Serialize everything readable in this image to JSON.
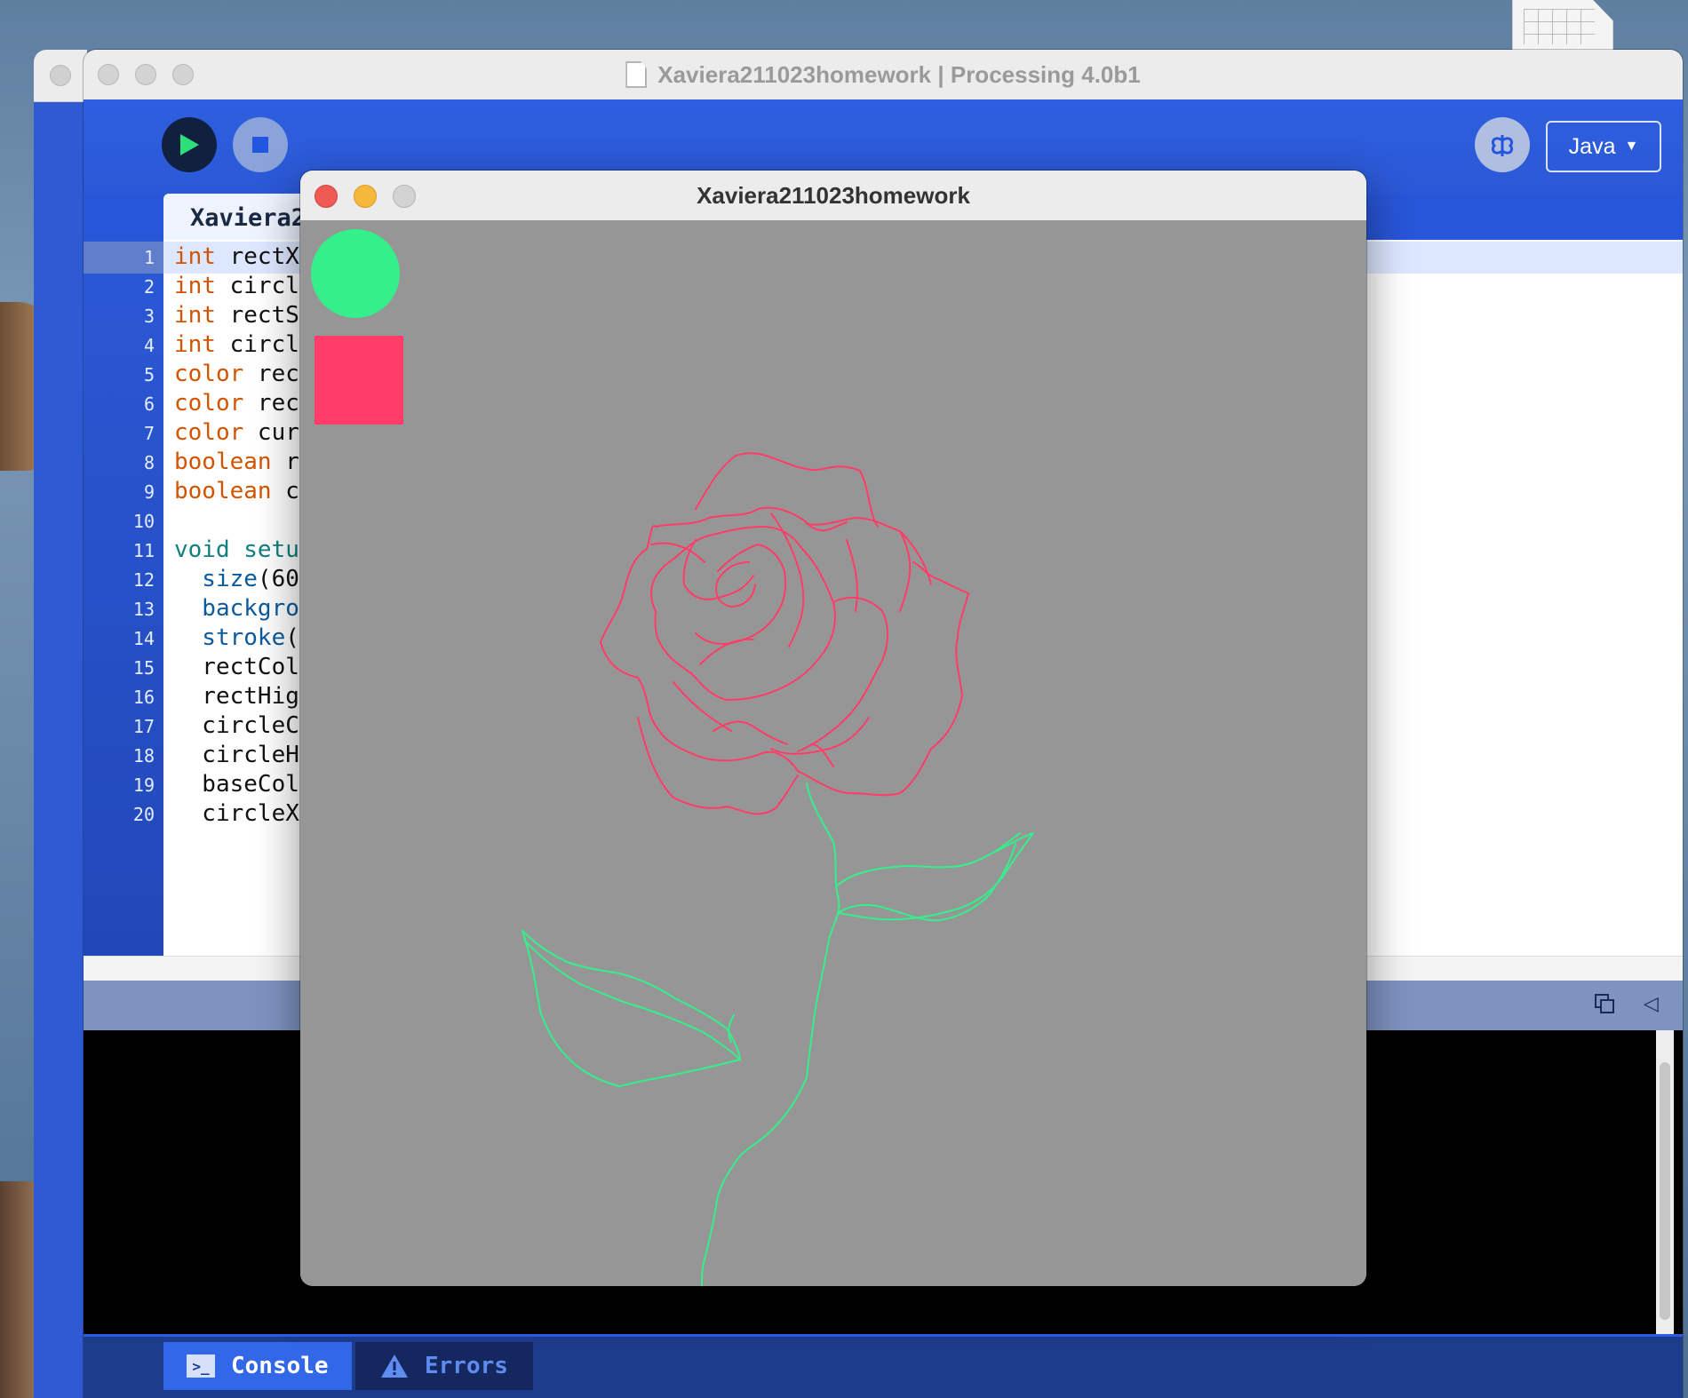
{
  "window": {
    "title": "Xaviera211023homework | Processing 4.0b1",
    "mode": "Java"
  },
  "editor": {
    "tab_label": "Xaviera2",
    "line_numbers": [
      "1",
      "2",
      "3",
      "4",
      "5",
      "6",
      "7",
      "8",
      "9",
      "10",
      "11",
      "12",
      "13",
      "14",
      "15",
      "16",
      "17",
      "18",
      "19",
      "20"
    ],
    "lines": [
      {
        "kw": "int",
        "rest": " rectX",
        "kind": "kw"
      },
      {
        "kw": "int",
        "rest": " circl",
        "kind": "kw"
      },
      {
        "kw": "int",
        "rest": " rectS",
        "kind": "kw"
      },
      {
        "kw": "int",
        "rest": " circl",
        "kind": "kw"
      },
      {
        "kw": "color",
        "rest": " rec",
        "kind": "kw"
      },
      {
        "kw": "color",
        "rest": " rec",
        "kind": "kw"
      },
      {
        "kw": "color",
        "rest": " cur",
        "kind": "kw"
      },
      {
        "kw": "boolean",
        "rest": " r",
        "kind": "kw"
      },
      {
        "kw": "boolean",
        "rest": " c",
        "kind": "kw"
      },
      {
        "kw": "",
        "rest": "",
        "kind": "plain"
      },
      {
        "kw": "void setu",
        "rest": "",
        "kind": "fn"
      },
      {
        "kw": "  size",
        "rest": "(60",
        "kind": "call"
      },
      {
        "kw": "  backgro",
        "rest": "",
        "kind": "call"
      },
      {
        "kw": "  stroke",
        "rest": "(",
        "kind": "call"
      },
      {
        "kw": "",
        "rest": "  rectCol",
        "kind": "plain"
      },
      {
        "kw": "",
        "rest": "  rectHig",
        "kind": "plain"
      },
      {
        "kw": "",
        "rest": "  circleC",
        "kind": "plain"
      },
      {
        "kw": "",
        "rest": "  circleH",
        "kind": "plain"
      },
      {
        "kw": "",
        "rest": "  baseCol",
        "kind": "plain"
      },
      {
        "kw": "",
        "rest": "  circleX",
        "kind": "plain"
      }
    ]
  },
  "bottom_tabs": {
    "console": "Console",
    "errors": "Errors"
  },
  "sketch": {
    "title": "Xaviera211023homework",
    "background_color": "#969696",
    "circle_button_color": "#35ef8b",
    "rect_button_color": "#ff3d68"
  },
  "colors": {
    "accent": "#2856d8",
    "keyword": "#d35400",
    "function": "#117f7f"
  },
  "icons": {
    "run": "play-icon",
    "stop": "stop-icon",
    "debug": "butterfly-debug-icon",
    "copy": "copy-icon",
    "collapse": "triangle-left-icon",
    "console": "terminal-icon",
    "errors": "warning-icon"
  }
}
